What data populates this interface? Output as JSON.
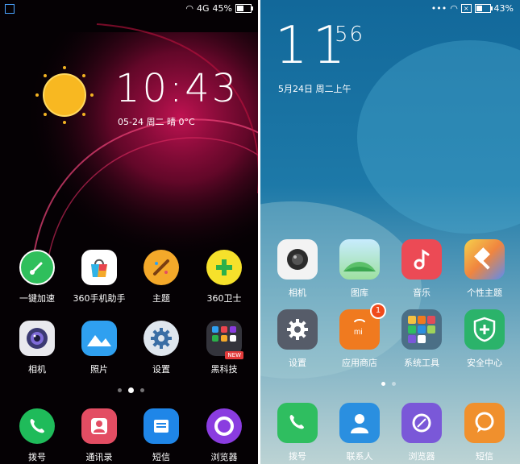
{
  "left": {
    "status": {
      "network": "4G",
      "battery": "45%",
      "battery_level": 0.45
    },
    "clock": {
      "time": "10:43",
      "date": "05-24",
      "weekday": "周二",
      "weather": "晴",
      "temp": "0°C"
    },
    "apps_row1": [
      {
        "label": "一键加速",
        "icon": "speed-gauge-icon",
        "color": "#2fbf5c"
      },
      {
        "label": "360手机助手",
        "icon": "app-store-bag-icon",
        "color": "#ffffff"
      },
      {
        "label": "主题",
        "icon": "palette-brush-icon",
        "color": "#f4a92a"
      },
      {
        "label": "360卫士",
        "icon": "plus-shield-icon",
        "color": "#f6e12b"
      }
    ],
    "apps_row2": [
      {
        "label": "相机",
        "icon": "camera-lens-icon",
        "color": "#e9e9ee"
      },
      {
        "label": "照片",
        "icon": "mountain-photo-icon",
        "color": "#2fa0f0"
      },
      {
        "label": "设置",
        "icon": "gear-icon",
        "color": "#dfe6ee"
      },
      {
        "label": "黑科技",
        "icon": "folder-icon",
        "color": "#34343c",
        "tag": "NEW"
      }
    ],
    "dock": [
      {
        "label": "拨号",
        "icon": "phone-icon",
        "color": "#1fbb5a"
      },
      {
        "label": "通讯录",
        "icon": "contact-icon",
        "color": "#e34d63"
      },
      {
        "label": "短信",
        "icon": "message-icon",
        "color": "#1f86e8"
      },
      {
        "label": "浏览器",
        "icon": "browser-ring-icon",
        "color": "#8a3ce0"
      }
    ]
  },
  "right": {
    "status": {
      "battery": "43%",
      "battery_level": 0.43
    },
    "clock": {
      "hour": "11",
      "minute": "56",
      "date": "5月24日 周二上午"
    },
    "apps_row1": [
      {
        "label": "相机",
        "icon": "camera-lens-icon",
        "color": "#f3f3f3"
      },
      {
        "label": "图库",
        "icon": "landscape-icon",
        "color": "#7bd27b"
      },
      {
        "label": "音乐",
        "icon": "music-note-icon",
        "color": "#ec4a55"
      },
      {
        "label": "个性主题",
        "icon": "paint-roller-icon",
        "color": "#f0c049"
      }
    ],
    "apps_row2": [
      {
        "label": "设置",
        "icon": "gear-icon",
        "color": "#565c69"
      },
      {
        "label": "应用商店",
        "icon": "mi-store-bag-icon",
        "color": "#f07a1f",
        "badge": "1"
      },
      {
        "label": "系统工具",
        "icon": "folder-icon",
        "color": "#4b6f86"
      },
      {
        "label": "安全中心",
        "icon": "shield-plus-icon",
        "color": "#2bb36a"
      }
    ],
    "dock": [
      {
        "label": "拨号",
        "icon": "phone-icon",
        "color": "#2fbe60"
      },
      {
        "label": "联系人",
        "icon": "person-icon",
        "color": "#2a8fe0"
      },
      {
        "label": "浏览器",
        "icon": "browser-swirl-icon",
        "color": "#7a58d8"
      },
      {
        "label": "短信",
        "icon": "chat-bubble-icon",
        "color": "#f0902d"
      }
    ]
  }
}
